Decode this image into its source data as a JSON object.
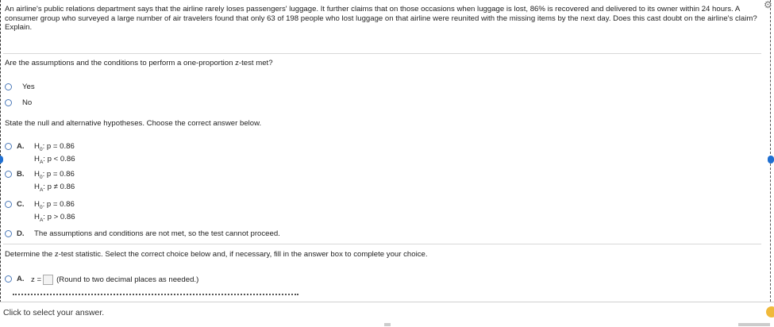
{
  "question": {
    "text": "An airline's public relations department says that the airline rarely loses passengers' luggage. It further claims that on those occasions when luggage is lost, 86% is recovered and delivered to its owner within 24 hours. A consumer group who surveyed a large number of air travelers found that only 63 of 198 people who lost luggage on that airline were reunited with the missing items by the next day. Does this cast doubt on the airline's claim? Explain."
  },
  "part1": {
    "prompt": "Are the assumptions and the conditions to perform a one-proportion z-test met?",
    "options": [
      {
        "label": "Yes"
      },
      {
        "label": "No"
      }
    ]
  },
  "part2": {
    "prompt": "State the null and alternative hypotheses. Choose the correct answer below.",
    "options": [
      {
        "letter": "A.",
        "h0_prefix": "H",
        "h0_sub": "0",
        "h0_rest": ": p = 0.86",
        "ha_prefix": "H",
        "ha_sub": "A",
        "ha_rest": ": p < 0.86"
      },
      {
        "letter": "B.",
        "h0_prefix": "H",
        "h0_sub": "0",
        "h0_rest": ": p = 0.86",
        "ha_prefix": "H",
        "ha_sub": "A",
        "ha_rest": ": p ≠ 0.86"
      },
      {
        "letter": "C.",
        "h0_prefix": "H",
        "h0_sub": "0",
        "h0_rest": ": p = 0.86",
        "ha_prefix": "H",
        "ha_sub": "A",
        "ha_rest": ": p > 0.86"
      }
    ],
    "option_d": {
      "letter": "D.",
      "text": "The assumptions and conditions are not met, so the test cannot proceed."
    }
  },
  "part3": {
    "prompt": "Determine the z-test statistic. Select the correct choice below and, if necessary, fill in the answer box to complete your choice.",
    "option_a": {
      "letter": "A.",
      "z_label": "z =",
      "answer": "",
      "hint": "(Round to two decimal places as needed.)"
    }
  },
  "status": {
    "text": "Click to select your answer."
  },
  "colors": {
    "accent": "#1f6fd1",
    "radio_border": "#4b79b8",
    "help": "#f0b93a"
  },
  "icons": [
    "gear-icon",
    "help-icon",
    "radio-icon"
  ]
}
